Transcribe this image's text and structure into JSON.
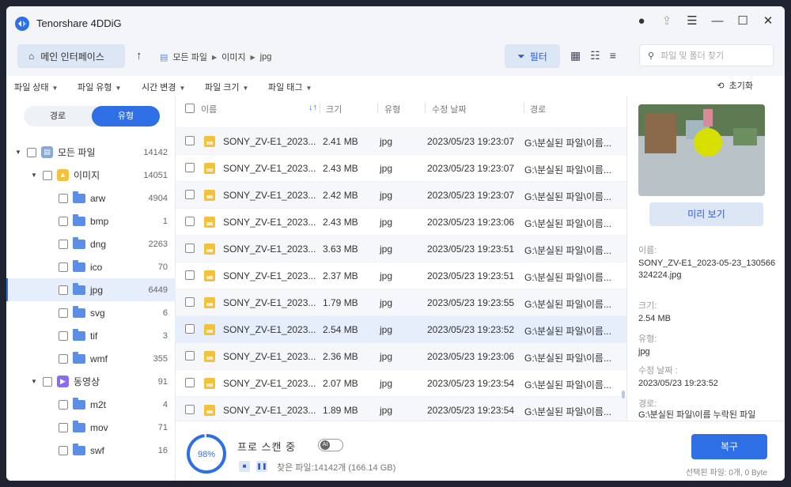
{
  "app": {
    "title": "Tenorshare 4DDiG"
  },
  "toolbar": {
    "home_label": "메인 인터페이스",
    "breadcrumb": [
      "모든 파일",
      "이미지",
      "jpg"
    ],
    "filter_label": "필터",
    "search_placeholder": "파일 및 폴더 찾기"
  },
  "filters": {
    "items": [
      "파일 상태",
      "파일 유형",
      "시간 변경",
      "파일 크기",
      "파일 태그"
    ],
    "reset_label": "초기화"
  },
  "sidebar": {
    "tabs": [
      "경로",
      "유형"
    ],
    "active_tab": "유형",
    "tree": [
      {
        "label": "모든 파일",
        "count": "14142"
      },
      {
        "label": "이미지",
        "count": "14051"
      },
      {
        "label": "arw",
        "count": "4904"
      },
      {
        "label": "bmp",
        "count": "1"
      },
      {
        "label": "dng",
        "count": "2263"
      },
      {
        "label": "ico",
        "count": "70"
      },
      {
        "label": "jpg",
        "count": "6449"
      },
      {
        "label": "svg",
        "count": "6"
      },
      {
        "label": "tif",
        "count": "3"
      },
      {
        "label": "wmf",
        "count": "355"
      },
      {
        "label": "동영상",
        "count": "91"
      },
      {
        "label": "m2t",
        "count": "4"
      },
      {
        "label": "mov",
        "count": "71"
      },
      {
        "label": "swf",
        "count": "16"
      }
    ]
  },
  "list": {
    "columns": [
      "이름",
      "크기",
      "유형",
      "수정 날짜",
      "경로"
    ],
    "rows": [
      {
        "name": "SONY_ZV-E1_2023...",
        "size": "2.41 MB",
        "type": "jpg",
        "date": "2023/05/23 19:23:07",
        "path": "G:\\분실된 파일\\이름..."
      },
      {
        "name": "SONY_ZV-E1_2023...",
        "size": "2.43 MB",
        "type": "jpg",
        "date": "2023/05/23 19:23:07",
        "path": "G:\\분실된 파일\\이름..."
      },
      {
        "name": "SONY_ZV-E1_2023...",
        "size": "2.42 MB",
        "type": "jpg",
        "date": "2023/05/23 19:23:07",
        "path": "G:\\분실된 파일\\이름..."
      },
      {
        "name": "SONY_ZV-E1_2023...",
        "size": "2.43 MB",
        "type": "jpg",
        "date": "2023/05/23 19:23:06",
        "path": "G:\\분실된 파일\\이름..."
      },
      {
        "name": "SONY_ZV-E1_2023...",
        "size": "3.63 MB",
        "type": "jpg",
        "date": "2023/05/23 19:23:51",
        "path": "G:\\분실된 파일\\이름..."
      },
      {
        "name": "SONY_ZV-E1_2023...",
        "size": "2.37 MB",
        "type": "jpg",
        "date": "2023/05/23 19:23:51",
        "path": "G:\\분실된 파일\\이름..."
      },
      {
        "name": "SONY_ZV-E1_2023...",
        "size": "1.79 MB",
        "type": "jpg",
        "date": "2023/05/23 19:23:55",
        "path": "G:\\분실된 파일\\이름..."
      },
      {
        "name": "SONY_ZV-E1_2023...",
        "size": "2.54 MB",
        "type": "jpg",
        "date": "2023/05/23 19:23:52",
        "path": "G:\\분실된 파일\\이름..."
      },
      {
        "name": "SONY_ZV-E1_2023...",
        "size": "2.36 MB",
        "type": "jpg",
        "date": "2023/05/23 19:23:06",
        "path": "G:\\분실된 파일\\이름..."
      },
      {
        "name": "SONY_ZV-E1_2023...",
        "size": "2.07 MB",
        "type": "jpg",
        "date": "2023/05/23 19:23:54",
        "path": "G:\\분실된 파일\\이름..."
      },
      {
        "name": "SONY_ZV-E1_2023...",
        "size": "1.89 MB",
        "type": "jpg",
        "date": "2023/05/23 19:23:54",
        "path": "G:\\분실된 파일\\이름..."
      }
    ]
  },
  "preview": {
    "button_label": "미리 보기",
    "name_label": "이름:",
    "name_value": "SONY_ZV-E1_2023-05-23_130566324224.jpg",
    "size_label": "크기:",
    "size_value": "2.54 MB",
    "type_label": "유형:",
    "type_value": "jpg",
    "date_label": "수정 날짜 :",
    "date_value": "2023/05/23 19:23:52",
    "path_label": "경로:",
    "path_value": "G:\\분실된 파일\\이름 누락된 파일"
  },
  "bottom": {
    "progress": "98%",
    "scan_title": "프로 스캔 중",
    "found_text": "찾은 파일:14142개 (166.14 GB)",
    "recover_label": "복구",
    "selected_text": "선택된 파일: 0개, 0 Byte"
  }
}
